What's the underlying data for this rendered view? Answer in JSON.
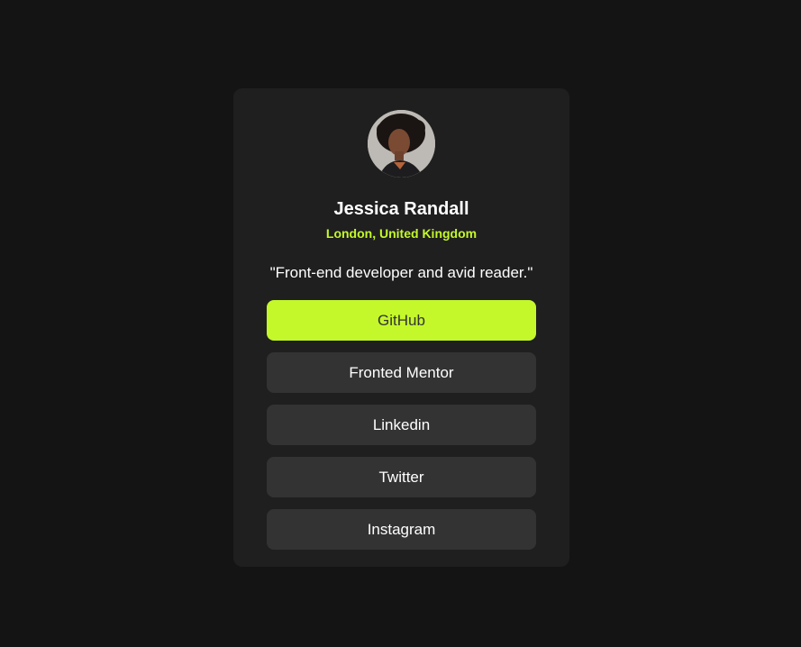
{
  "profile": {
    "name": "Jessica Randall",
    "location": "London, United Kingdom",
    "bio": "\"Front-end developer and avid reader.\""
  },
  "links": [
    {
      "label": "GitHub",
      "active": true
    },
    {
      "label": "Fronted Mentor",
      "active": false
    },
    {
      "label": "Linkedin",
      "active": false
    },
    {
      "label": "Twitter",
      "active": false
    },
    {
      "label": "Instagram",
      "active": false
    }
  ],
  "colors": {
    "background": "#141414",
    "card": "#1f1f1f",
    "button": "#333333",
    "accent": "#c4f82a",
    "text": "#ffffff"
  }
}
